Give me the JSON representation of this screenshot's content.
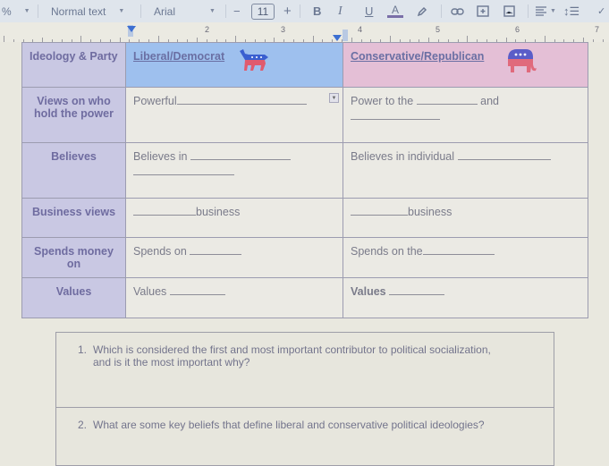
{
  "toolbar": {
    "zoom_fragment": "%",
    "style_select": "Normal text",
    "font_select": "Arial",
    "font_size_decrease": "−",
    "font_size": "11",
    "font_size_increase": "+",
    "bold": "B",
    "italic": "I",
    "underline": "U",
    "text_color": "A",
    "icons": [
      "highlight-pen-icon",
      "link-icon",
      "insert-comment-icon",
      "insert-image-icon",
      "align-left-icon",
      "line-spacing-icon",
      "checklist-icon"
    ]
  },
  "ruler": {
    "labels": [
      "2",
      "3",
      "4",
      "5",
      "6",
      "7"
    ]
  },
  "table": {
    "header": {
      "row_label": "Ideology & Party",
      "liberal": "Liberal/Democrat",
      "conservative": "Conservative/Republican"
    },
    "rows": [
      {
        "label": "Views on who hold the power",
        "liberal": {
          "before": "Powerful",
          "after": ""
        },
        "conservative": {
          "before": "Power to the",
          "after": "and"
        }
      },
      {
        "label": "Believes",
        "liberal": {
          "before": "Believes in",
          "after": ""
        },
        "conservative": {
          "before": "Believes in individual",
          "after": ""
        }
      },
      {
        "label": "Business views",
        "liberal": {
          "before": "",
          "after": "business"
        },
        "conservative": {
          "before": "",
          "after": "business"
        }
      },
      {
        "label": "Spends money on",
        "liberal": {
          "before": "Spends on",
          "after": ""
        },
        "conservative": {
          "before": "Spends on the",
          "after": ""
        }
      },
      {
        "label": "Values",
        "liberal": {
          "before": "Values",
          "after": ""
        },
        "conservative": {
          "before": "Values",
          "after": ""
        }
      }
    ],
    "colors": {
      "row_header_bg": "#c9c8e3",
      "liberal_header_bg": "#9ec0ee",
      "conservative_header_bg": "#e4bfd6"
    }
  },
  "questions": [
    {
      "number": "1.",
      "line1": "Which is considered the first and most important contributor to political socialization,",
      "line2": "and is it the most important why?"
    },
    {
      "number": "2.",
      "line1": "What are some key beliefs that define liberal and conservative political ideologies?"
    }
  ]
}
